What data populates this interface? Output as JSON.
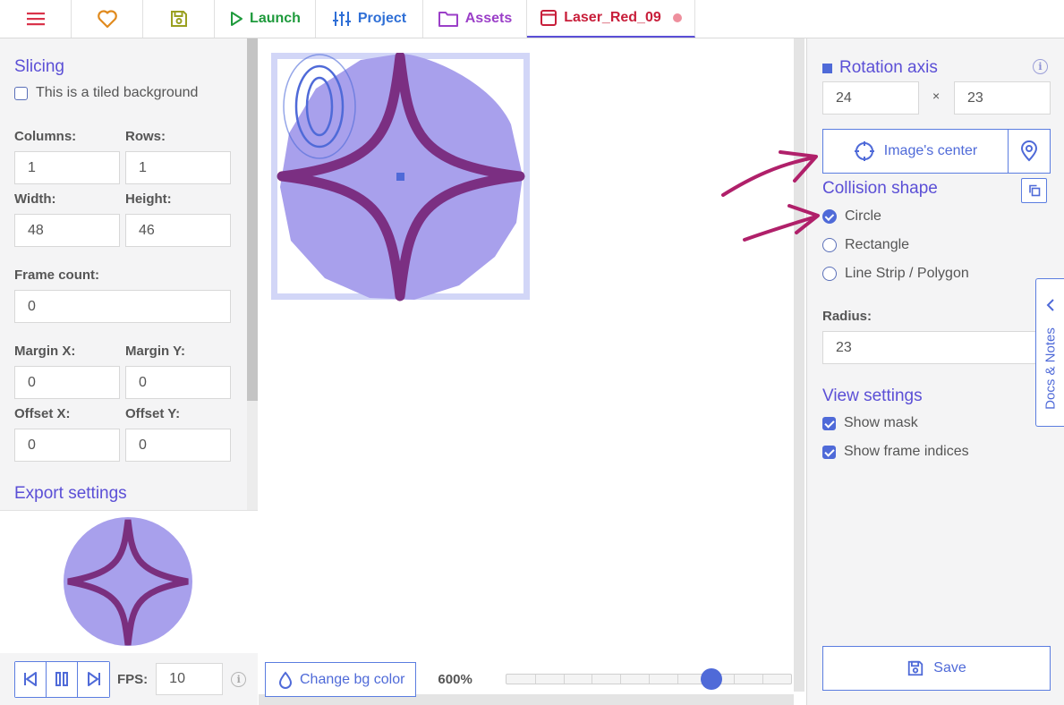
{
  "tabs": {
    "menu_icon": "hamburger-icon",
    "favorite_icon": "heart-icon",
    "save_icon": "floppy-icon",
    "launch": "Launch",
    "project": "Project",
    "assets": "Assets",
    "current": "Laser_Red_09",
    "colors": {
      "launch": "#1e9a3c",
      "project": "#2f6fd6",
      "assets": "#9b3fc8",
      "current": "#c81e3a",
      "menu": "#d9334a",
      "heart": "#e08a1e",
      "save": "#9aa020"
    }
  },
  "slicing": {
    "title": "Slicing",
    "tiled_label": "This is a tiled background",
    "tiled_checked": false,
    "columns_label": "Columns:",
    "columns": "1",
    "rows_label": "Rows:",
    "rows": "1",
    "width_label": "Width:",
    "width": "48",
    "height_label": "Height:",
    "height": "46",
    "frame_count_label": "Frame count:",
    "frame_count": "0",
    "margin_x_label": "Margin X:",
    "margin_x": "0",
    "margin_y_label": "Margin Y:",
    "margin_y": "0",
    "offset_x_label": "Offset X:",
    "offset_x": "0",
    "offset_y_label": "Offset Y:",
    "offset_y": "0",
    "export_title": "Export settings"
  },
  "player": {
    "fps_label": "FPS:",
    "fps": "10"
  },
  "canvas": {
    "change_bg_label": "Change bg color",
    "zoom": "600%",
    "zoom_level": 0.72,
    "frame_index": "0"
  },
  "rotation": {
    "title": "Rotation axis",
    "x": "24",
    "sep": "×",
    "y": "23",
    "center_button": "Image's center"
  },
  "collision": {
    "title": "Collision shape",
    "options": [
      "Circle",
      "Rectangle",
      "Line Strip / Polygon"
    ],
    "selected": "Circle",
    "radius_label": "Radius:",
    "radius": "23"
  },
  "view": {
    "title": "View settings",
    "show_mask": "Show mask",
    "show_mask_checked": true,
    "show_frame_indices": "Show frame indices",
    "show_frame_indices_checked": true
  },
  "save_button": "Save",
  "docs_tab": "Docs & Notes"
}
